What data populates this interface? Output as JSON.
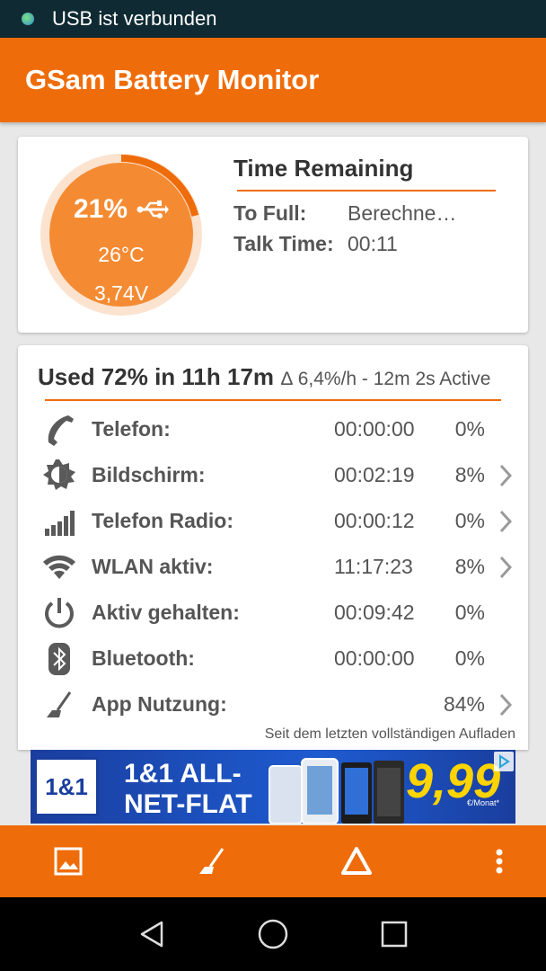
{
  "status_bar": {
    "notification": "USB ist verbunden"
  },
  "app": {
    "title": "GSam Battery Monitor",
    "accent": "#ef6c0a"
  },
  "battery": {
    "percent": "21%",
    "temperature": "26°C",
    "voltage": "3,74V",
    "level": 0.21,
    "charging_icon": "usb-icon"
  },
  "time_remaining": {
    "title": "Time Remaining",
    "to_full_label": "To Full:",
    "to_full_value": "Berechne…",
    "talk_time_label": "Talk Time:",
    "talk_time_value": "00:11"
  },
  "usage": {
    "headline": "Used 72% in 11h 17m",
    "rate": "∆ 6,4%/h - 12m 2s Active",
    "rows": [
      {
        "icon": "phone-icon",
        "label": "Telefon:",
        "time": "00:00:00",
        "percent": "0%",
        "has_chevron": false
      },
      {
        "icon": "brightness-icon",
        "label": "Bildschirm:",
        "time": "00:02:19",
        "percent": "8%",
        "has_chevron": true
      },
      {
        "icon": "signal-icon",
        "label": "Telefon Radio:",
        "time": "00:00:12",
        "percent": "0%",
        "has_chevron": true
      },
      {
        "icon": "wifi-icon",
        "label": "WLAN aktiv:",
        "time": "11:17:23",
        "percent": "8%",
        "has_chevron": true
      },
      {
        "icon": "power-icon",
        "label": "Aktiv gehalten:",
        "time": "00:09:42",
        "percent": "0%",
        "has_chevron": false
      },
      {
        "icon": "bluetooth-icon",
        "label": "Bluetooth:",
        "time": "00:00:00",
        "percent": "0%",
        "has_chevron": false
      },
      {
        "icon": "broom-icon",
        "label": "App Nutzung:",
        "time": "",
        "percent": "84%",
        "has_chevron": true
      }
    ],
    "since_note": "Seit dem letzten vollständigen Aufladen"
  },
  "ad": {
    "logo": "1&1",
    "line1": "1&1 ALL-",
    "line2": "NET-FLAT",
    "price": "9,99",
    "price_note": "€/Monat*"
  },
  "bottom_bar": [
    "image-icon",
    "broom-icon",
    "delta-icon",
    "more-vert-icon"
  ],
  "nav_bar": [
    "back-icon",
    "home-icon",
    "recents-icon"
  ]
}
